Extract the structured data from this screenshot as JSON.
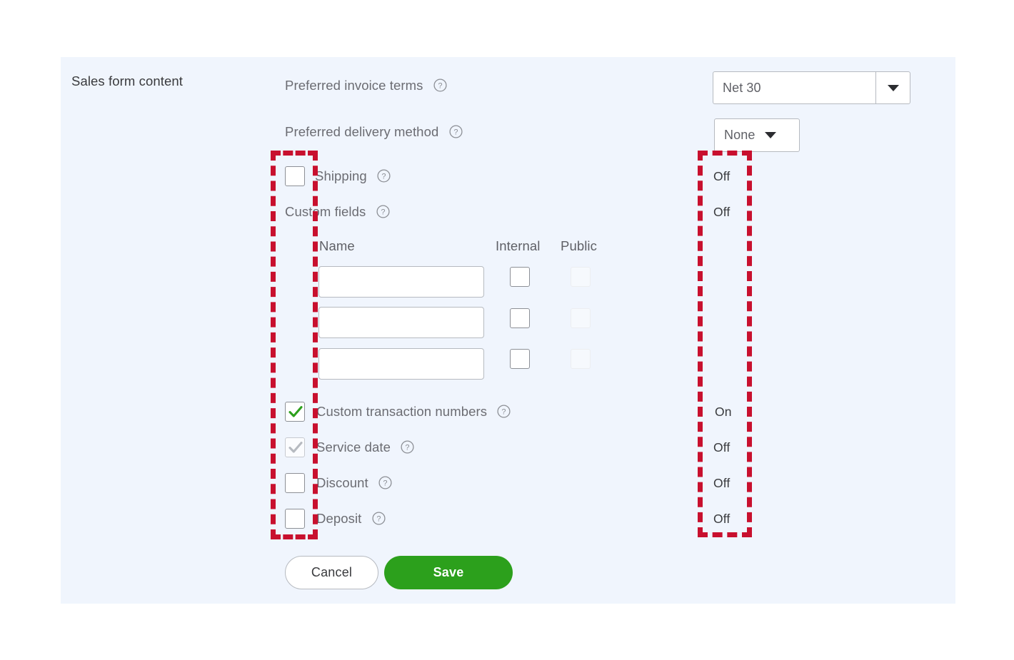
{
  "panel": {
    "background_color": "#f0f5fd",
    "section_title": "Sales form content"
  },
  "colors": {
    "accent_green": "#2ca01c",
    "annotation_red": "#c8102e",
    "label_gray": "#6b6c72",
    "border_gray": "#b6bac0"
  },
  "fields": {
    "preferred_invoice_terms": {
      "label": "Preferred invoice terms",
      "help_icon": "question-circle-icon",
      "value": "Net 30",
      "caret_icon": "caret-down-icon"
    },
    "preferred_delivery_method": {
      "label": "Preferred delivery method",
      "help_icon": "question-circle-icon",
      "value": "None",
      "caret_icon": "caret-down-icon"
    }
  },
  "toggles": [
    {
      "id": "shipping",
      "label": "Shipping",
      "help_icon": "question-circle-icon",
      "checked": false,
      "disabled": false,
      "status": "Off",
      "has_checkbox": true
    },
    {
      "id": "custom-fields",
      "label": "Custom fields",
      "help_icon": "question-circle-icon",
      "checked": false,
      "disabled": false,
      "status": "Off",
      "has_checkbox": false
    },
    {
      "id": "custom-transaction-numbers",
      "label": "Custom transaction numbers",
      "help_icon": "question-circle-icon",
      "checked": true,
      "disabled": false,
      "status": "On",
      "has_checkbox": true
    },
    {
      "id": "service-date",
      "label": "Service date",
      "help_icon": "question-circle-icon",
      "checked": true,
      "disabled": true,
      "status": "Off",
      "has_checkbox": true
    },
    {
      "id": "discount",
      "label": "Discount",
      "help_icon": "question-circle-icon",
      "checked": false,
      "disabled": false,
      "status": "Off",
      "has_checkbox": true
    },
    {
      "id": "deposit",
      "label": "Deposit",
      "help_icon": "question-circle-icon",
      "checked": false,
      "disabled": false,
      "status": "Off",
      "has_checkbox": true
    }
  ],
  "custom_fields_table": {
    "columns": [
      "Name",
      "Internal",
      "Public"
    ],
    "rows": [
      {
        "name": "",
        "internal_checked": false,
        "public_checked": false,
        "public_disabled": true
      },
      {
        "name": "",
        "internal_checked": false,
        "public_checked": false,
        "public_disabled": true
      },
      {
        "name": "",
        "internal_checked": false,
        "public_checked": false,
        "public_disabled": true
      }
    ],
    "name_placeholder": ""
  },
  "buttons": {
    "cancel": "Cancel",
    "save": "Save"
  },
  "annotations": [
    {
      "id": "checkbox-column-highlight",
      "shape": "dashed-rect"
    },
    {
      "id": "status-column-highlight",
      "shape": "dashed-rect"
    }
  ]
}
